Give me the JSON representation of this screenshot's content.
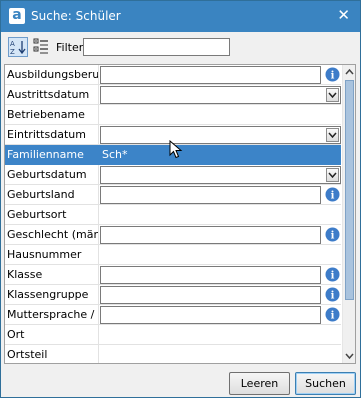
{
  "window": {
    "title": "Suche: Schüler",
    "app_letter": "a",
    "close_glyph": "✕"
  },
  "toolbar": {
    "filter_label": "Filter",
    "filter_value": ""
  },
  "fields": [
    {
      "label": "Ausbildungsberuf",
      "value": ""
    },
    {
      "label": "Austrittsdatum",
      "value": ""
    },
    {
      "label": "Betriebename",
      "value": ""
    },
    {
      "label": "Eintrittsdatum",
      "value": ""
    },
    {
      "label": "Familienname",
      "value": "Sch*"
    },
    {
      "label": "Geburtsdatum",
      "value": ""
    },
    {
      "label": "Geburtsland",
      "value": ""
    },
    {
      "label": "Geburtsort",
      "value": ""
    },
    {
      "label": "Geschlecht (män…",
      "value": ""
    },
    {
      "label": "Hausnummer",
      "value": ""
    },
    {
      "label": "Klasse",
      "value": ""
    },
    {
      "label": "Klassengruppe",
      "value": ""
    },
    {
      "label": "Muttersprache / …",
      "value": ""
    },
    {
      "label": "Ort",
      "value": ""
    },
    {
      "label": "Ortsteil",
      "value": ""
    }
  ],
  "buttons": {
    "clear": "Leeren",
    "search": "Suchen"
  },
  "colors": {
    "titlebar": "#3a84c1",
    "selection": "#3c84c8",
    "info": "#3d7cc9"
  }
}
